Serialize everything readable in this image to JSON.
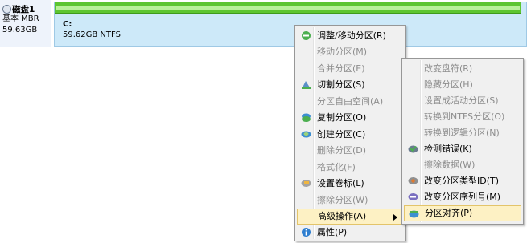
{
  "disk": {
    "name": "磁盘1",
    "type": "基本 MBR",
    "size": "59.63GB"
  },
  "partition": {
    "letter": "C:",
    "info": "59.62GB NTFS",
    "usage_fraction": 0.99
  },
  "context_menu": {
    "items": [
      {
        "label": "调整/移动分区(R)",
        "enabled": true,
        "icon": "resize-icon"
      },
      {
        "label": "移动分区(M)",
        "enabled": false
      },
      {
        "label": "合并分区(E)",
        "enabled": false
      },
      {
        "label": "切割分区(S)",
        "enabled": true,
        "icon": "split-icon"
      },
      {
        "label": "分区自由空间(A)",
        "enabled": false
      },
      {
        "label": "复制分区(O)",
        "enabled": true,
        "icon": "copy-icon"
      },
      {
        "label": "创建分区(C)",
        "enabled": true,
        "icon": "create-icon"
      },
      {
        "label": "删除分区(D)",
        "enabled": false
      },
      {
        "label": "格式化(F)",
        "enabled": false
      },
      {
        "label": "设置卷标(L)",
        "enabled": true,
        "icon": "label-icon"
      },
      {
        "label": "擦除分区(W)",
        "enabled": false
      },
      {
        "label": "高级操作(A)",
        "enabled": true,
        "highlighted": true
      },
      {
        "label": "属性(P)",
        "enabled": true,
        "icon": "info-icon"
      }
    ]
  },
  "submenu": {
    "items": [
      {
        "label": "改变盘符(R)",
        "enabled": false
      },
      {
        "label": "隐藏分区(H)",
        "enabled": false
      },
      {
        "label": "设置成活动分区(S)",
        "enabled": false
      },
      {
        "label": "转换到NTFS分区(O)",
        "enabled": false
      },
      {
        "label": "转换到逻辑分区(N)",
        "enabled": false
      },
      {
        "label": "检测错误(K)",
        "enabled": true,
        "icon": "check-icon"
      },
      {
        "label": "擦除数据(W)",
        "enabled": false
      },
      {
        "label": "改变分区类型ID(T)",
        "enabled": true,
        "icon": "type-icon"
      },
      {
        "label": "改变分区序列号(M)",
        "enabled": true,
        "icon": "serial-icon"
      },
      {
        "label": "分区对齐(P)",
        "enabled": true,
        "icon": "align-icon",
        "highlighted": true
      }
    ]
  }
}
